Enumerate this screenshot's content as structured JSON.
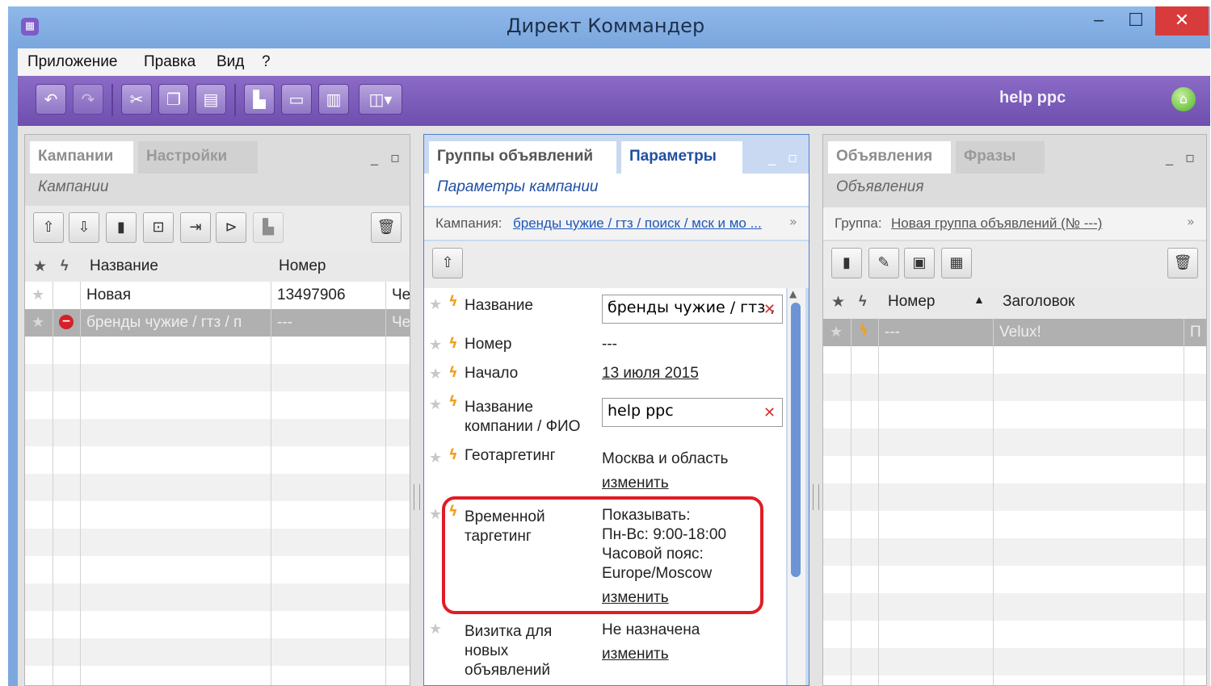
{
  "window": {
    "title": "Директ Коммандер",
    "minimize": "‒",
    "maximize": "☐",
    "close": "✕"
  },
  "menu": [
    "Приложение",
    "Правка",
    "Вид",
    "?"
  ],
  "toolbar": {
    "user": "help ppc"
  },
  "left_panel": {
    "tabs": [
      "Кампании",
      "Настройки"
    ],
    "subtitle": "Кампании",
    "columns": [
      "Название",
      "Номер"
    ],
    "rows": [
      {
        "name": "Новая",
        "number": "13497906",
        "extra": "Че"
      },
      {
        "name": "бренды чужие / гтз / п",
        "number": "---",
        "extra": "Че"
      }
    ]
  },
  "middle_panel": {
    "tabs": [
      "Группы объявлений",
      "Параметры"
    ],
    "subtitle": "Параметры кампании",
    "campaign_label": "Кампания:",
    "campaign_link": "бренды чужие / гтз / поиск / мск и мо ...",
    "fields": {
      "name_label": "Название",
      "name_value": "бренды чужие / гтз ,",
      "number_label": "Номер",
      "number_value": "---",
      "start_label": "Начало",
      "start_value": "13 июля 2015",
      "company_label_1": "Название",
      "company_label_2": "компании / ФИО",
      "company_value": "help ppc",
      "geo_label": "Геотаргетинг",
      "geo_value": "Москва и область",
      "geo_change": "изменить",
      "time_label_1": "Временной",
      "time_label_2": "таргетинг",
      "time_line_1": "Показывать:",
      "time_line_2": "Пн-Вс: 9:00-18:00",
      "time_line_3": "Часовой пояс:",
      "time_line_4": "Europe/Moscow",
      "time_change": "изменить",
      "vcard_label_1": "Визитка для",
      "vcard_label_2": "новых",
      "vcard_label_3": "объявлений",
      "vcard_value": "Не назначена",
      "vcard_change": "изменить"
    }
  },
  "right_panel": {
    "tabs": [
      "Объявления",
      "Фразы"
    ],
    "subtitle": "Объявления",
    "group_label": "Группа:",
    "group_link": "Новая группа объявлений (№ ---)",
    "columns": [
      "Номер",
      "Заголовок"
    ],
    "sort_indicator": "▲",
    "rows": [
      {
        "number": "---",
        "title": "Velux!",
        "extra": "П"
      }
    ]
  },
  "colors": {
    "toolbar": "#7a5bbb",
    "active_panel": "#c9d9f1",
    "highlight": "#e01d25",
    "link": "#1f57b8"
  }
}
